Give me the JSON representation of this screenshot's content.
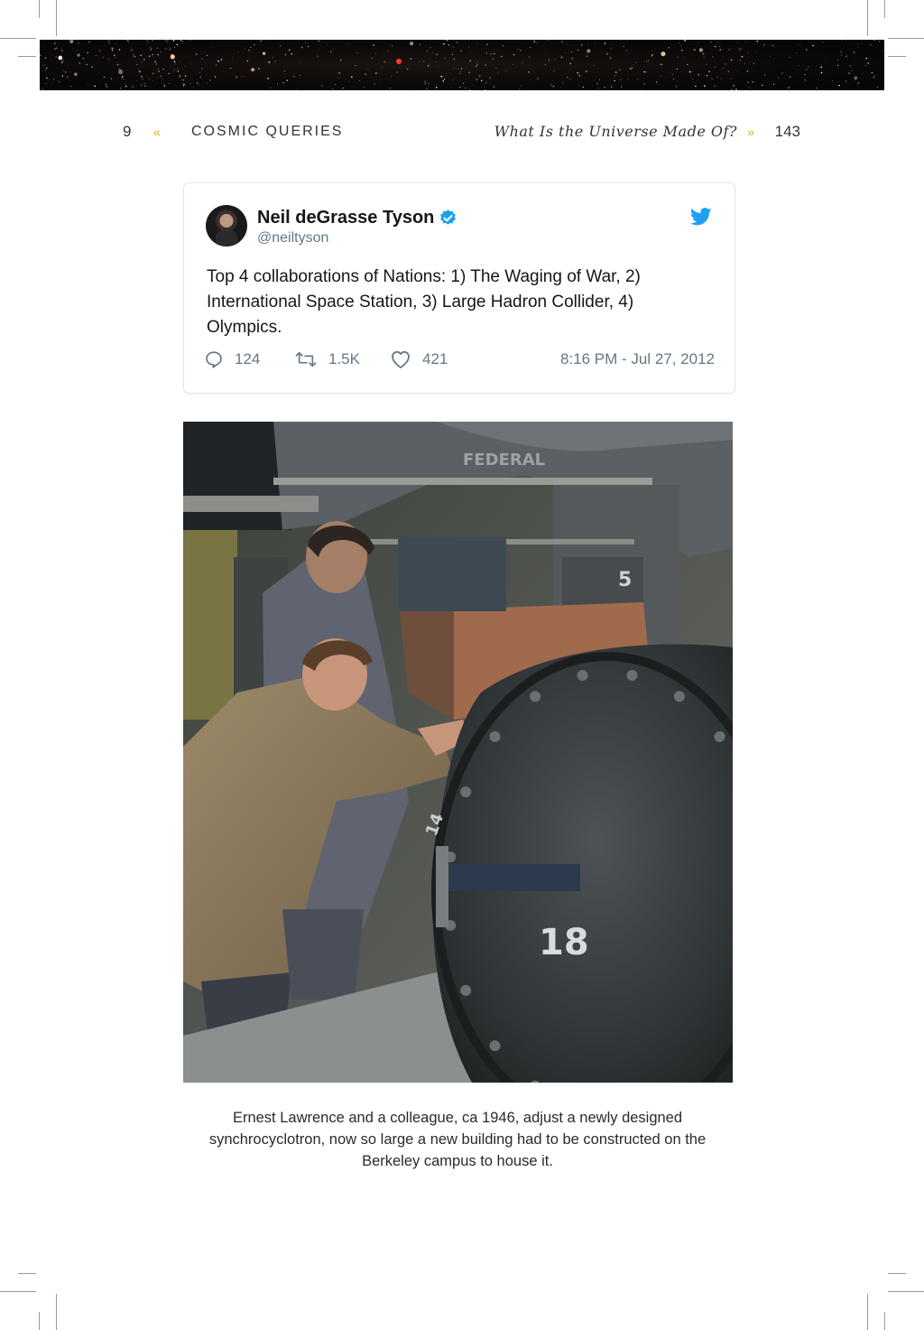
{
  "header": {
    "left_page_number": "9",
    "left_arrow": "«",
    "left_title": "COSMIC QUERIES",
    "right_title": "What Is the Universe Made Of?",
    "right_arrow": "»",
    "right_page_number": "143"
  },
  "tweet": {
    "name": "Neil deGrasse Tyson",
    "handle": "@neiltyson",
    "text": "Top 4 collaborations of Nations: 1) The Waging of War, 2) International Space Station, 3) Large Hadron Collider, 4) Olympics.",
    "replies": "124",
    "retweets": "1.5K",
    "likes": "421",
    "timestamp": "8:16 PM - Jul 27, 2012",
    "icons": [
      "verified-badge-icon",
      "twitter-bird-icon",
      "reply-icon",
      "retweet-icon",
      "like-icon"
    ],
    "colors": {
      "accent": "#1da1f2",
      "muted": "#657786"
    }
  },
  "photo": {
    "stencil_labels": [
      "FEDERAL",
      "5",
      "18",
      "14"
    ]
  },
  "caption": "Ernest Lawrence and a colleague, ca 1946, adjust a newly designed synchrocyclotron, now so large a new building had to be constructed on the Berkeley campus to house it."
}
